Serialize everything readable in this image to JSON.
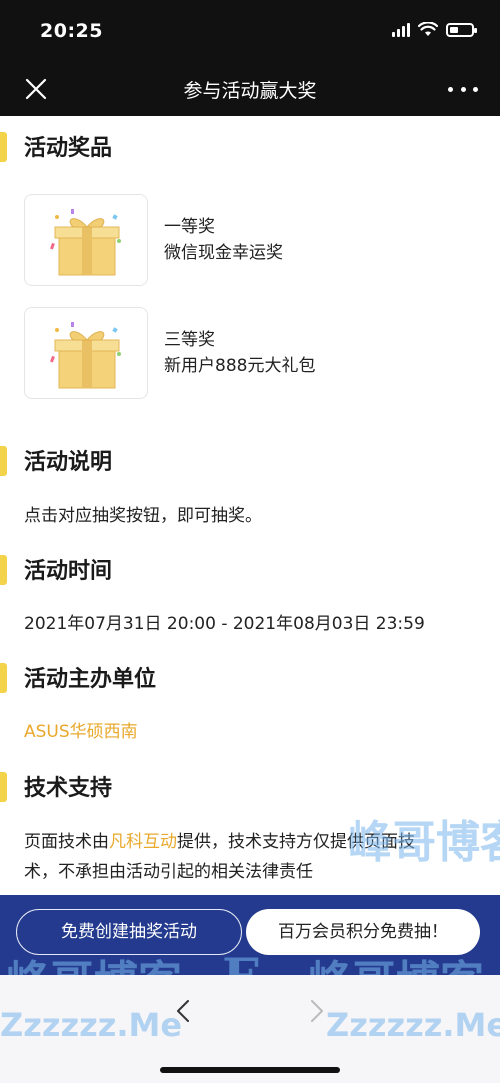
{
  "status_bar": {
    "time": "20:25"
  },
  "nav": {
    "title": "参与活动赢大奖"
  },
  "sections": {
    "prizes": {
      "title": "活动奖品"
    },
    "description": {
      "title": "活动说明",
      "text": "点击对应抽奖按钮，即可抽奖。"
    },
    "time": {
      "title": "活动时间",
      "text": "2021年07月31日 20:00 - 2021年08月03日 23:59"
    },
    "organizer": {
      "title": "活动主办单位",
      "name": "ASUS华硕西南"
    },
    "support": {
      "title": "技术支持",
      "line1_before": "页面技术由",
      "provider": "凡科互动",
      "line1_after": "提供，技术支持方仅提供页面技",
      "line2": "术，不承担由活动引起的相关法律责任"
    }
  },
  "prizes": [
    {
      "level": "一等奖",
      "name": "微信现金幸运奖",
      "icon": "gift-box-icon"
    },
    {
      "level": "三等奖",
      "name": "新用户888元大礼包",
      "icon": "gift-box-icon"
    }
  ],
  "footer": {
    "create_label": "免费创建抽奖活动",
    "points_label": "百万会员积分免费抽！"
  },
  "watermark": {
    "brand": "峰哥博客",
    "domain": "Zzzzzz.Me",
    "letter": "F"
  },
  "colors": {
    "accent_yellow": "#f3d34a",
    "link_orange": "#e9a92c",
    "footer_blue": "#233a8e",
    "header_dark": "#111111"
  }
}
